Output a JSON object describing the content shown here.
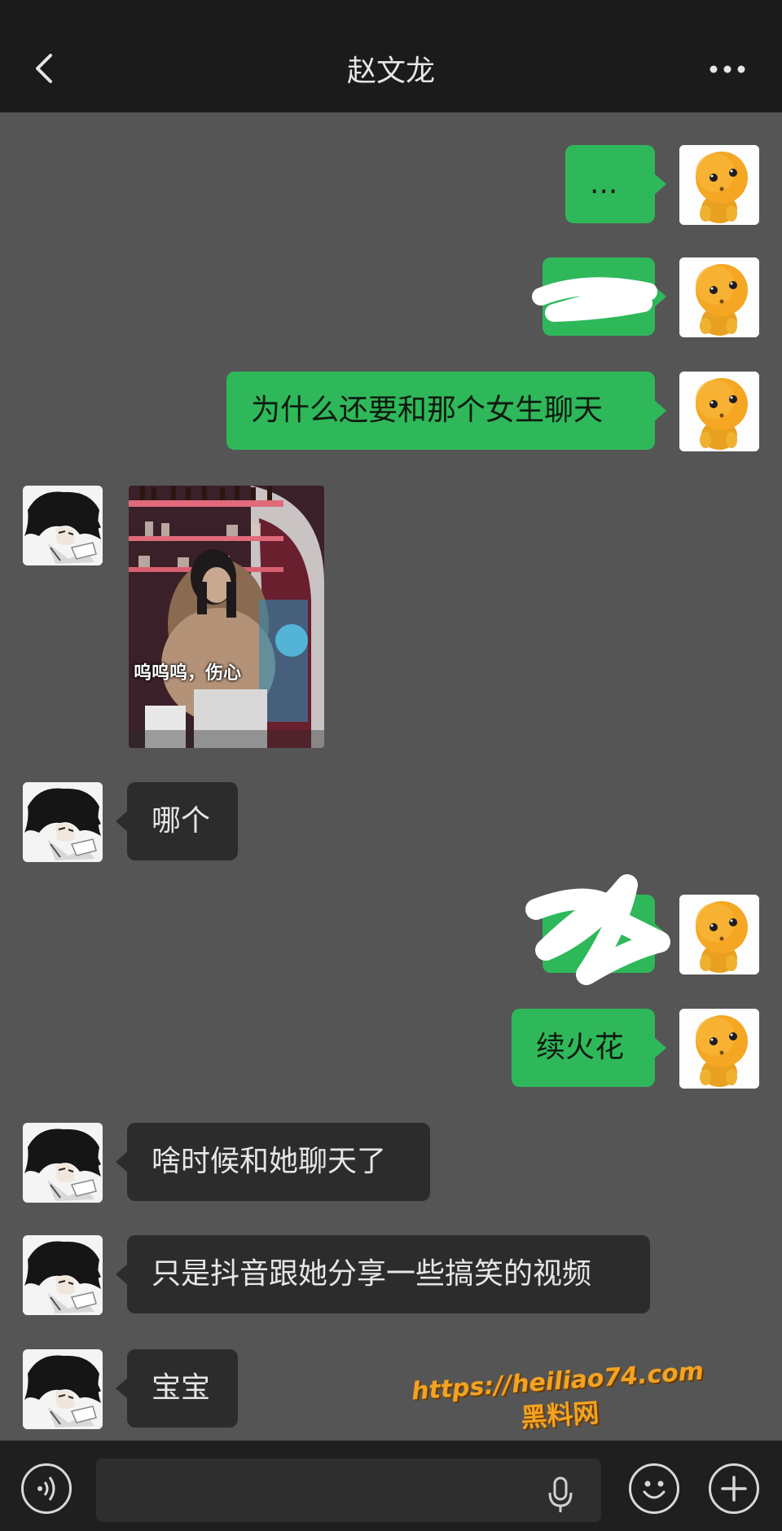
{
  "header": {
    "title": "赵文龙",
    "back_icon": "chevron-left-icon",
    "more_icon": "more-dots-icon"
  },
  "messages": [
    {
      "side": "me",
      "type": "text",
      "text": "..."
    },
    {
      "side": "me",
      "type": "redacted"
    },
    {
      "side": "me",
      "type": "text",
      "text": "为什么还要和那个女生聊天"
    },
    {
      "side": "them",
      "type": "image",
      "caption": "呜呜呜，伤心"
    },
    {
      "side": "them",
      "type": "text",
      "text": "哪个"
    },
    {
      "side": "me",
      "type": "redacted"
    },
    {
      "side": "me",
      "type": "text",
      "text": "续火花"
    },
    {
      "side": "them",
      "type": "text",
      "text": "啥时候和她聊天了"
    },
    {
      "side": "them",
      "type": "text",
      "text": "只是抖音跟她分享一些搞笑的视频"
    },
    {
      "side": "them",
      "type": "text",
      "text": "宝宝"
    }
  ],
  "watermark": {
    "url": "https://heiliao74.com",
    "name": "黑料网"
  },
  "footer": {
    "voice_icon": "voice-icon",
    "mic_icon": "microphone-icon",
    "emoji_icon": "emoji-icon",
    "plus_icon": "plus-icon"
  },
  "colors": {
    "chat_background": "#555555",
    "my_bubble": "#2fb85a",
    "their_bubble": "#2c2c2c",
    "bar_background": "#1b1b1b"
  }
}
